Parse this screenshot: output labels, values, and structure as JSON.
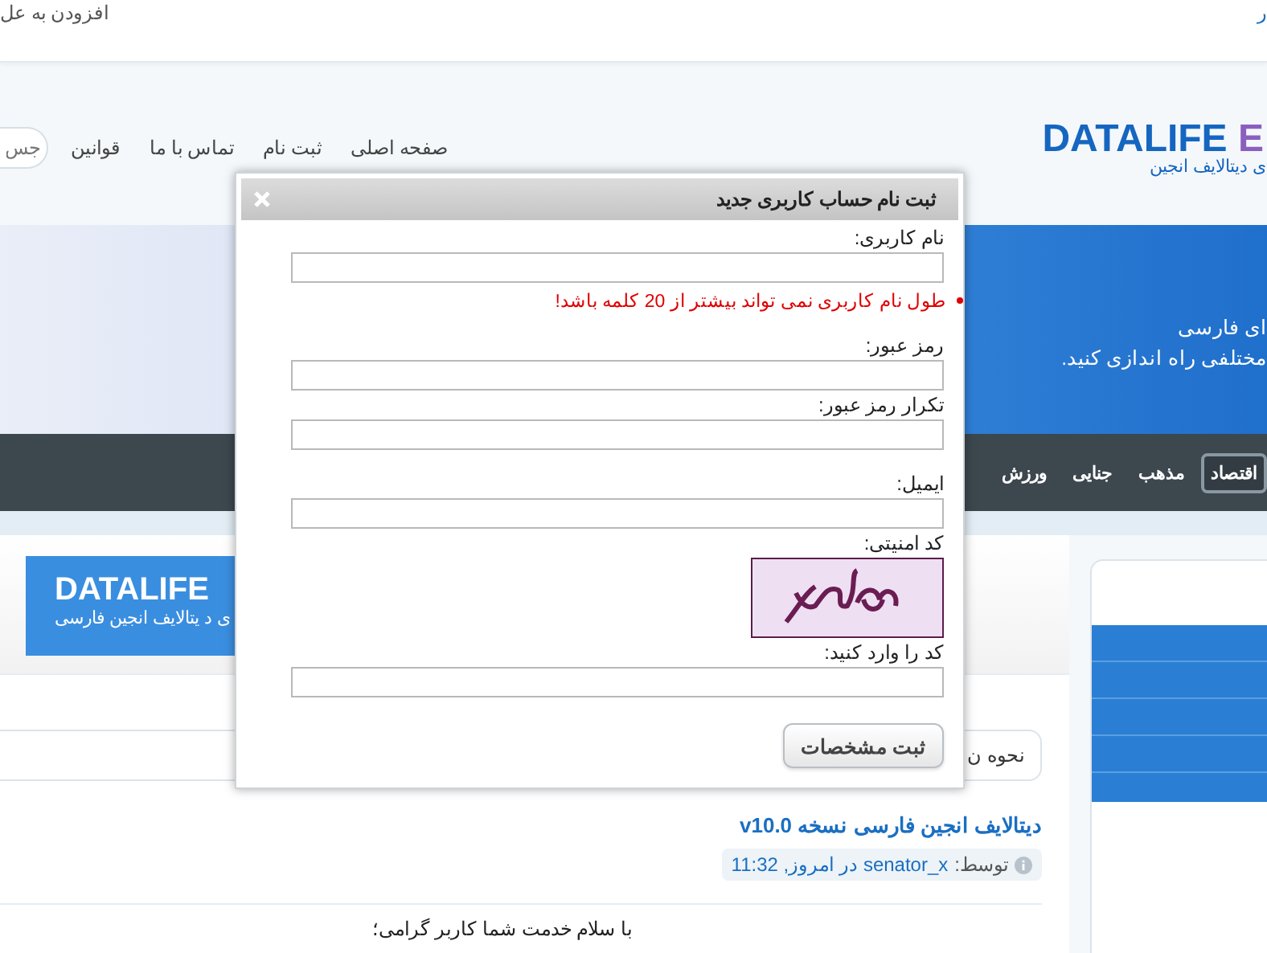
{
  "top_bar": {
    "link_left": "افزودن به عل",
    "link_right": "ر"
  },
  "header": {
    "logo": {
      "text": "DATALIFE",
      "accent": "E"
    },
    "tagline": "ی دیتالایف انجین",
    "nav": [
      "صفحه اصلی",
      "ثبت نام",
      "تماس با ما",
      "قوانین"
    ],
    "search": {
      "placeholder": "جس"
    }
  },
  "banner": {
    "lines": [
      "ای فارسی",
      "مختلفی راه اندازی کنید."
    ]
  },
  "categories": [
    {
      "label": "اقتصاد",
      "selected": true
    },
    {
      "label": "مذهب",
      "selected": false
    },
    {
      "label": "جنایی",
      "selected": false
    },
    {
      "label": "ورزش",
      "selected": false
    }
  ],
  "ad_banner": {
    "logo": "DATALIFE",
    "tagline": "ی د یتالایف انجین فارسی"
  },
  "info_box": {
    "text": "نحوه ن"
  },
  "article": {
    "title": "دیتالایف انجین فارسی نسخه v10.0",
    "meta": {
      "prefix": "توسط:",
      "author": "senator_x",
      "date": "در امروز, 11:32"
    },
    "body": "با سلام خدمت شما کاربر گرامی؛"
  },
  "dialog": {
    "title": "ثبت نام حساب کاربری جدید",
    "groups": [
      [
        {
          "kind": "text",
          "label": "نام کاربری:",
          "error": "طول نام کاربری نمی تواند بیشتر از 20 کلمه باشد!"
        }
      ],
      [
        {
          "kind": "text",
          "label": "رمز عبور:"
        },
        {
          "kind": "text",
          "label": "تکرار رمز عبور:"
        }
      ],
      [
        {
          "kind": "text",
          "label": "ایمیل:"
        },
        {
          "kind": "captcha",
          "label": "کد امنیتی:"
        },
        {
          "kind": "text",
          "label": "کد را وارد کنید:"
        }
      ]
    ],
    "submit": "ثبت مشخصات"
  }
}
